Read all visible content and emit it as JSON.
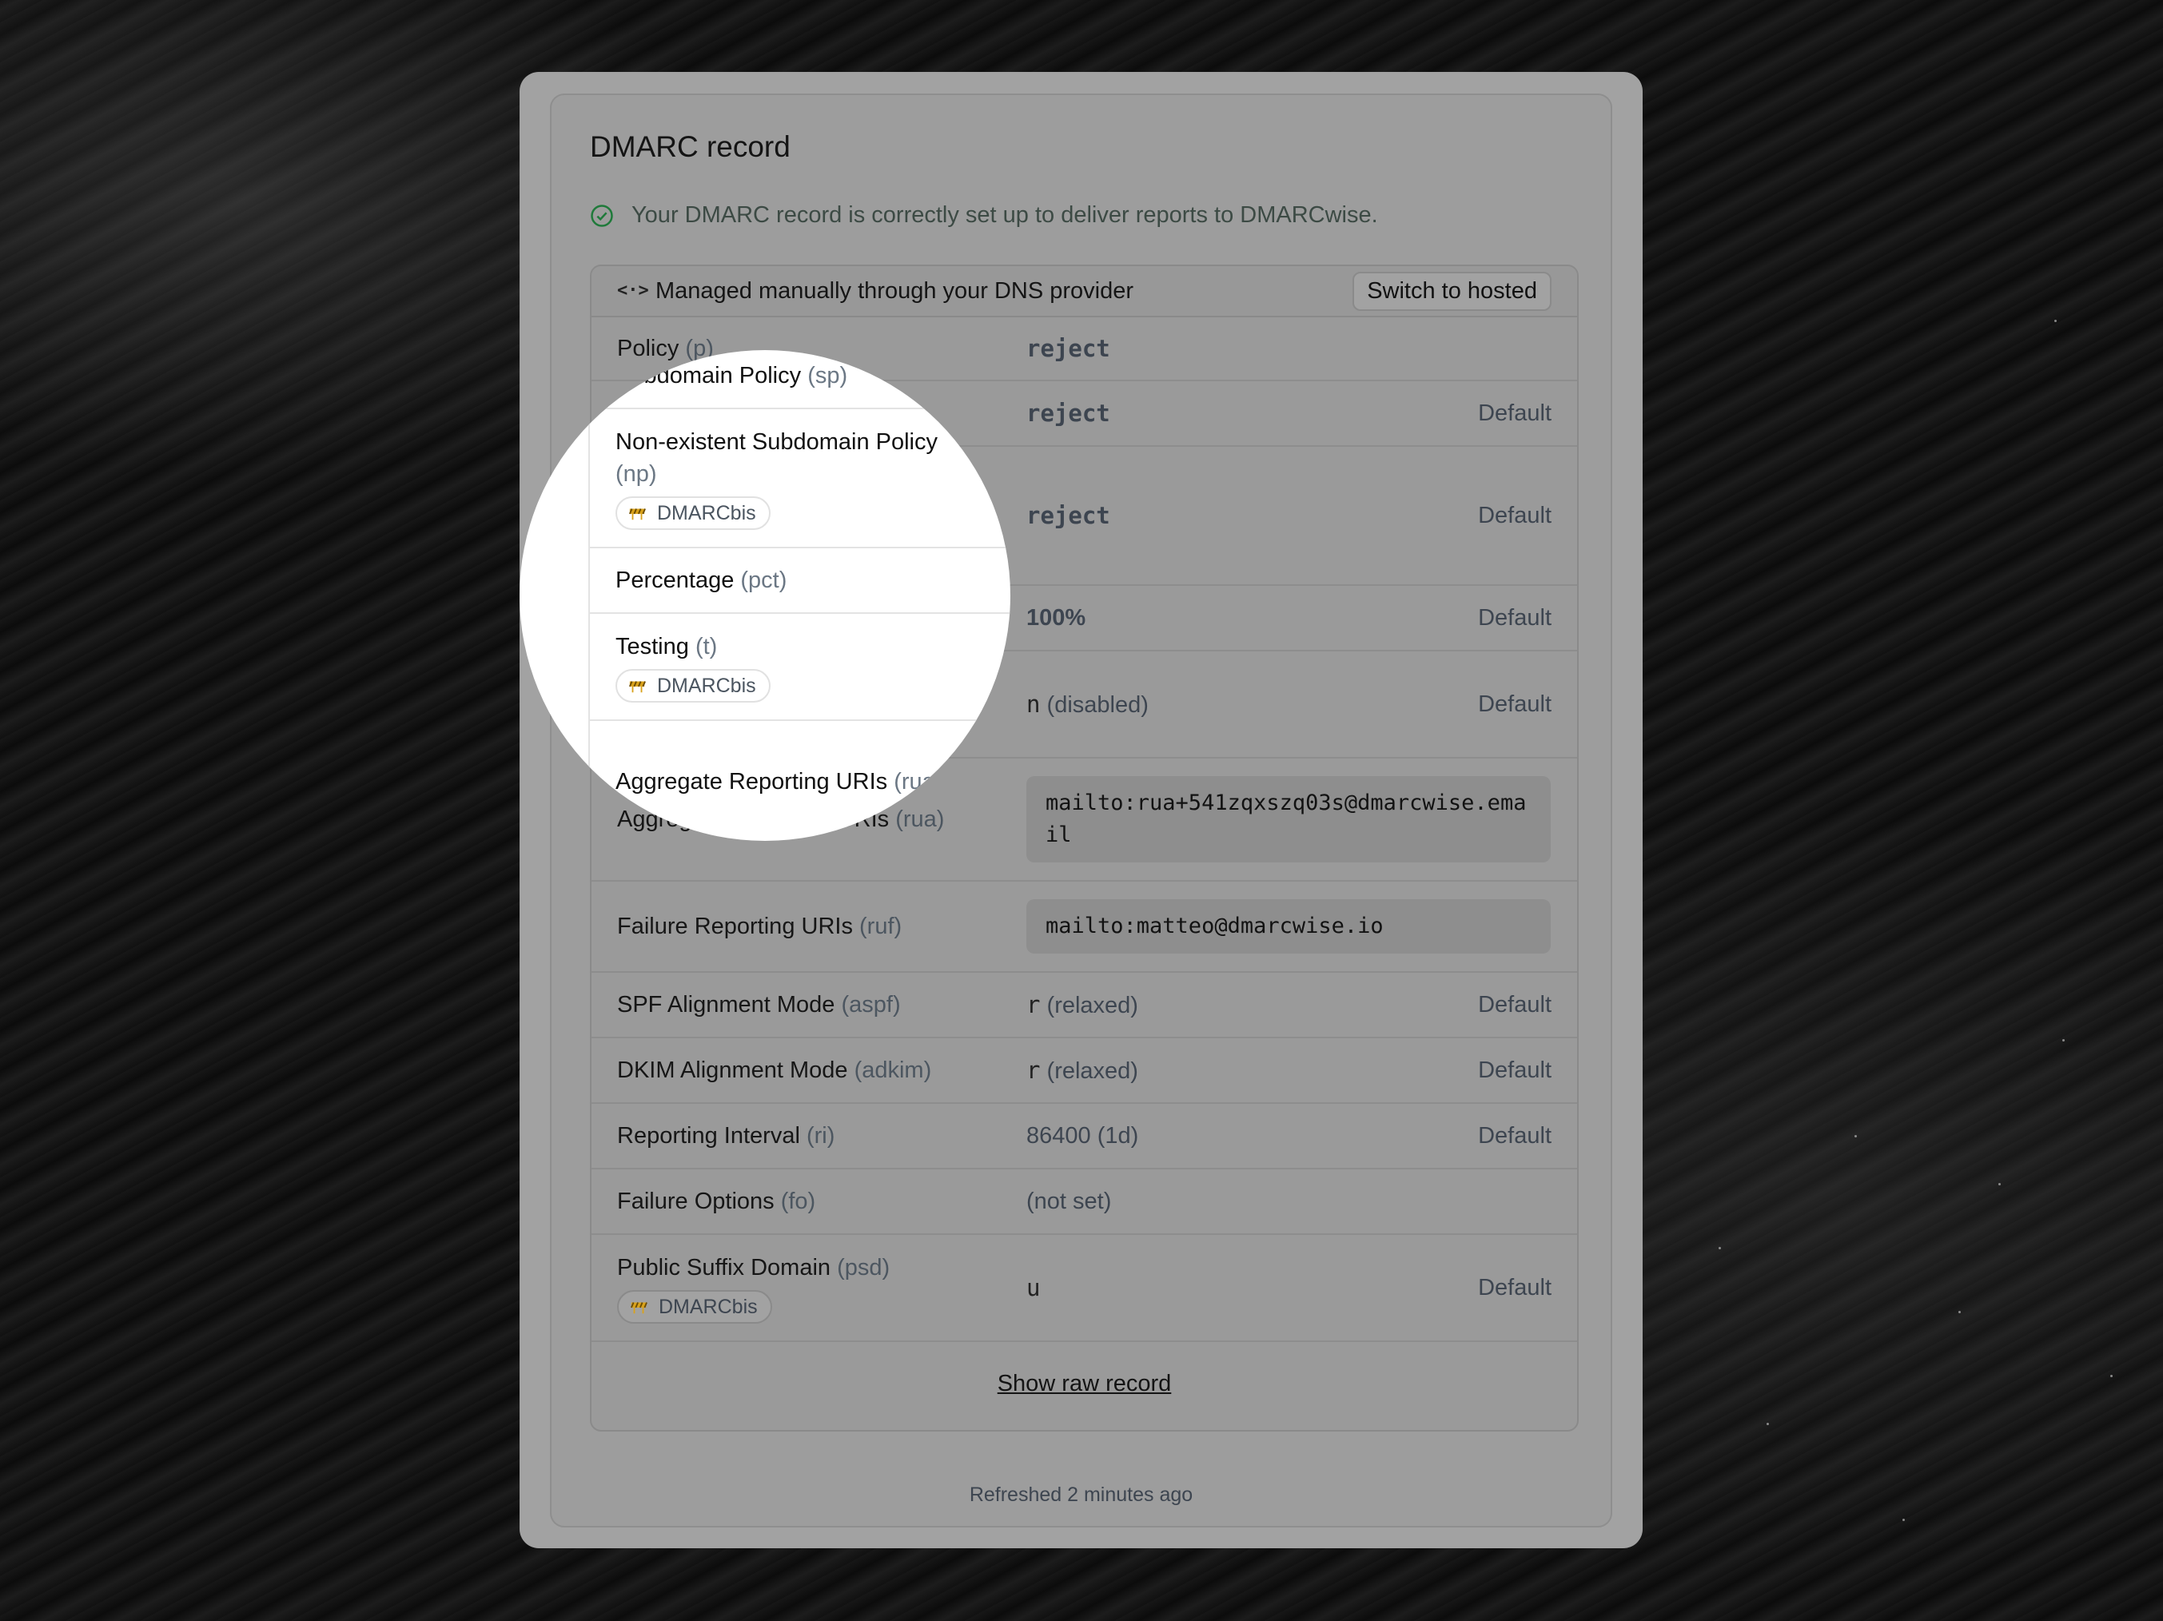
{
  "card": {
    "title": "DMARC record",
    "status_text": "Your DMARC record is correctly set up to deliver reports to DMARCwise.",
    "status_icon": "check-circle-icon",
    "status_color": "#1f7a3a"
  },
  "panel": {
    "management_icon": "code-icon",
    "management_label": "Managed manually through your DNS provider",
    "switch_button": "Switch to hosted",
    "code_glyph": "<·>"
  },
  "badge_label": "DMARCbis",
  "default_label": "Default",
  "rows": {
    "policy": {
      "label": "Policy",
      "key": "(p)",
      "value": "reject"
    },
    "subdomain_policy": {
      "label": "Subdomain Policy",
      "key": "(sp)",
      "value": "reject",
      "default": "Default"
    },
    "np_policy": {
      "label": "Non-existent Subdomain Policy",
      "key": "(np)",
      "value": "reject",
      "default": "Default"
    },
    "percentage": {
      "label": "Percentage",
      "key": "(pct)",
      "value": "100%",
      "default": "Default"
    },
    "testing": {
      "label": "Testing",
      "key": "(t)",
      "value_code": "n",
      "value_text": "(disabled)",
      "default": "Default"
    },
    "rua": {
      "label": "Aggregate Reporting URIs",
      "key": "(rua)",
      "value": "mailto:rua+541zqxszq03s@dmarcwise.email"
    },
    "ruf": {
      "label": "Failure Reporting URIs",
      "key": "(ruf)",
      "value": "mailto:matteo@dmarcwise.io"
    },
    "aspf": {
      "label": "SPF Alignment Mode",
      "key": "(aspf)",
      "value_code": "r",
      "value_text": "(relaxed)",
      "default": "Default"
    },
    "adkim": {
      "label": "DKIM Alignment Mode",
      "key": "(adkim)",
      "value_code": "r",
      "value_text": "(relaxed)",
      "default": "Default"
    },
    "ri": {
      "label": "Reporting Interval",
      "key": "(ri)",
      "value": "86400 (1d)",
      "default": "Default"
    },
    "fo": {
      "label": "Failure Options",
      "key": "(fo)",
      "value": "(not set)"
    },
    "psd": {
      "label": "Public Suffix Domain",
      "key": "(psd)",
      "value_code": "u",
      "default": "Default"
    }
  },
  "show_raw_record": "Show raw record",
  "refreshed_text": "Refreshed 2 minutes ago",
  "colors": {
    "accent_green": "#1c6b2e",
    "badge_icon": "#d9a21b"
  }
}
